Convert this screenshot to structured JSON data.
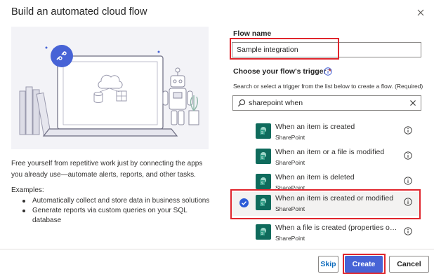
{
  "dialog": {
    "title": "Build an automated cloud flow"
  },
  "left_panel": {
    "description": "Free yourself from repetitive work just by connecting the apps you already use—automate alerts, reports, and other tasks.",
    "examples_title": "Examples:",
    "examples": [
      "Automatically collect and store data in business solutions",
      "Generate reports via custom queries on your SQL database"
    ]
  },
  "form": {
    "flow_name_label": "Flow name",
    "flow_name_value": "Sample integration",
    "trigger_label": "Choose your flow's trigger",
    "required_marker": "*",
    "trigger_helper": "Search or select a trigger from the list below to create a flow. (Required)",
    "search_value": "sharepoint when"
  },
  "triggers": [
    {
      "title": "When an item is created",
      "connector": "SharePoint",
      "selected": false
    },
    {
      "title": "When an item or a file is modified",
      "connector": "SharePoint",
      "selected": false
    },
    {
      "title": "When an item is deleted",
      "connector": "SharePoint",
      "selected": false
    },
    {
      "title": "When an item is created or modified",
      "connector": "SharePoint",
      "selected": true
    },
    {
      "title": "When a file is created (properties only)",
      "connector": "SharePoint",
      "selected": false
    }
  ],
  "footer": {
    "skip_label": "Skip",
    "create_label": "Create",
    "cancel_label": "Cancel"
  },
  "colors": {
    "accent": "#4763d6",
    "selected_check": "#2b5bd7",
    "sharepoint_tile": "#0f6b5c",
    "highlight": "#e0262d"
  },
  "icons": {
    "close": "close-icon",
    "info": "info-icon",
    "search": "search-icon",
    "clear": "clear-icon",
    "sharepoint": "sharepoint-icon",
    "check": "checkmark-icon"
  }
}
